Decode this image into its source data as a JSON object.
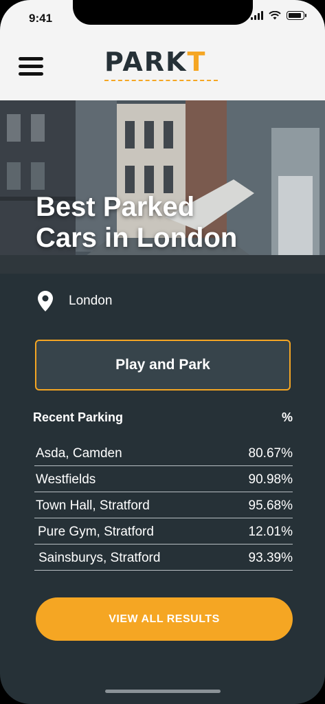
{
  "status_bar": {
    "time": "9:41"
  },
  "header": {
    "logo_main": "PARK",
    "logo_accent": "T"
  },
  "hero": {
    "title_line1": "Best Parked",
    "title_line2": "Cars in London"
  },
  "location": {
    "label": "London"
  },
  "play_button": {
    "label": "Play and Park"
  },
  "parking_table": {
    "heading": "Recent Parking",
    "percent_header": "%",
    "rows": [
      {
        "name": "Asda, Camden",
        "percent": "80.67%"
      },
      {
        "name": "Westfields",
        "percent": "90.98%"
      },
      {
        "name": "Town Hall, Stratford",
        "percent": "95.68%"
      },
      {
        "name": "Pure Gym, Stratford",
        "percent": "12.01%"
      },
      {
        "name": "Sainsburys, Stratford",
        "percent": "93.39%"
      }
    ]
  },
  "view_all": {
    "label": "VIEW ALL RESULTS"
  },
  "colors": {
    "accent": "#f5a623",
    "background": "#263137",
    "header_bg": "#f4f4f4",
    "button_bg": "#37444b"
  },
  "icons": [
    "menu-icon",
    "location-pin-icon",
    "signal-icon",
    "wifi-icon",
    "battery-icon"
  ]
}
